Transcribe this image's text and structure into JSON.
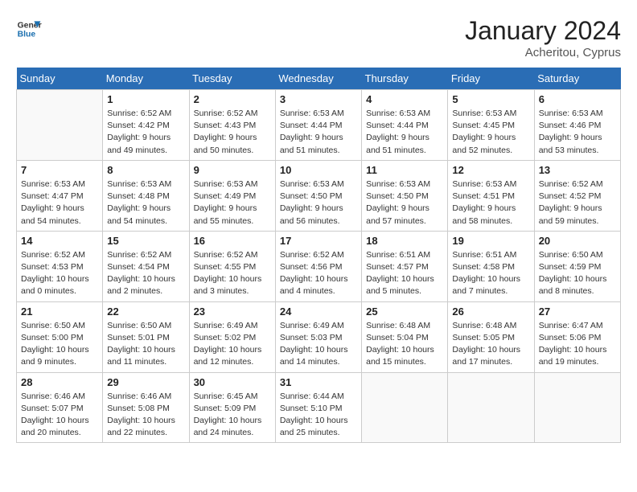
{
  "header": {
    "logo_line1": "General",
    "logo_line2": "Blue",
    "month_year": "January 2024",
    "location": "Acheritou, Cyprus"
  },
  "weekdays": [
    "Sunday",
    "Monday",
    "Tuesday",
    "Wednesday",
    "Thursday",
    "Friday",
    "Saturday"
  ],
  "weeks": [
    [
      {
        "day": "",
        "info": ""
      },
      {
        "day": "1",
        "info": "Sunrise: 6:52 AM\nSunset: 4:42 PM\nDaylight: 9 hours\nand 49 minutes."
      },
      {
        "day": "2",
        "info": "Sunrise: 6:52 AM\nSunset: 4:43 PM\nDaylight: 9 hours\nand 50 minutes."
      },
      {
        "day": "3",
        "info": "Sunrise: 6:53 AM\nSunset: 4:44 PM\nDaylight: 9 hours\nand 51 minutes."
      },
      {
        "day": "4",
        "info": "Sunrise: 6:53 AM\nSunset: 4:44 PM\nDaylight: 9 hours\nand 51 minutes."
      },
      {
        "day": "5",
        "info": "Sunrise: 6:53 AM\nSunset: 4:45 PM\nDaylight: 9 hours\nand 52 minutes."
      },
      {
        "day": "6",
        "info": "Sunrise: 6:53 AM\nSunset: 4:46 PM\nDaylight: 9 hours\nand 53 minutes."
      }
    ],
    [
      {
        "day": "7",
        "info": ""
      },
      {
        "day": "8",
        "info": "Sunrise: 6:53 AM\nSunset: 4:48 PM\nDaylight: 9 hours\nand 54 minutes."
      },
      {
        "day": "9",
        "info": "Sunrise: 6:53 AM\nSunset: 4:49 PM\nDaylight: 9 hours\nand 55 minutes."
      },
      {
        "day": "10",
        "info": "Sunrise: 6:53 AM\nSunset: 4:50 PM\nDaylight: 9 hours\nand 56 minutes."
      },
      {
        "day": "11",
        "info": "Sunrise: 6:53 AM\nSunset: 4:50 PM\nDaylight: 9 hours\nand 57 minutes."
      },
      {
        "day": "12",
        "info": "Sunrise: 6:53 AM\nSunset: 4:51 PM\nDaylight: 9 hours\nand 58 minutes."
      },
      {
        "day": "13",
        "info": "Sunrise: 6:52 AM\nSunset: 4:52 PM\nDaylight: 9 hours\nand 59 minutes."
      }
    ],
    [
      {
        "day": "14",
        "info": ""
      },
      {
        "day": "15",
        "info": "Sunrise: 6:52 AM\nSunset: 4:54 PM\nDaylight: 10 hours\nand 2 minutes."
      },
      {
        "day": "16",
        "info": "Sunrise: 6:52 AM\nSunset: 4:55 PM\nDaylight: 10 hours\nand 3 minutes."
      },
      {
        "day": "17",
        "info": "Sunrise: 6:52 AM\nSunset: 4:56 PM\nDaylight: 10 hours\nand 4 minutes."
      },
      {
        "day": "18",
        "info": "Sunrise: 6:51 AM\nSunset: 4:57 PM\nDaylight: 10 hours\nand 5 minutes."
      },
      {
        "day": "19",
        "info": "Sunrise: 6:51 AM\nSunset: 4:58 PM\nDaylight: 10 hours\nand 7 minutes."
      },
      {
        "day": "20",
        "info": "Sunrise: 6:50 AM\nSunset: 4:59 PM\nDaylight: 10 hours\nand 8 minutes."
      }
    ],
    [
      {
        "day": "21",
        "info": ""
      },
      {
        "day": "22",
        "info": "Sunrise: 6:50 AM\nSunset: 5:01 PM\nDaylight: 10 hours\nand 11 minutes."
      },
      {
        "day": "23",
        "info": "Sunrise: 6:49 AM\nSunset: 5:02 PM\nDaylight: 10 hours\nand 12 minutes."
      },
      {
        "day": "24",
        "info": "Sunrise: 6:49 AM\nSunset: 5:03 PM\nDaylight: 10 hours\nand 14 minutes."
      },
      {
        "day": "25",
        "info": "Sunrise: 6:48 AM\nSunset: 5:04 PM\nDaylight: 10 hours\nand 15 minutes."
      },
      {
        "day": "26",
        "info": "Sunrise: 6:48 AM\nSunset: 5:05 PM\nDaylight: 10 hours\nand 17 minutes."
      },
      {
        "day": "27",
        "info": "Sunrise: 6:47 AM\nSunset: 5:06 PM\nDaylight: 10 hours\nand 19 minutes."
      }
    ],
    [
      {
        "day": "28",
        "info": ""
      },
      {
        "day": "29",
        "info": "Sunrise: 6:46 AM\nSunset: 5:08 PM\nDaylight: 10 hours\nand 22 minutes."
      },
      {
        "day": "30",
        "info": "Sunrise: 6:45 AM\nSunset: 5:09 PM\nDaylight: 10 hours\nand 24 minutes."
      },
      {
        "day": "31",
        "info": "Sunrise: 6:44 AM\nSunset: 5:10 PM\nDaylight: 10 hours\nand 25 minutes."
      },
      {
        "day": "",
        "info": ""
      },
      {
        "day": "",
        "info": ""
      },
      {
        "day": "",
        "info": ""
      }
    ]
  ],
  "week1_day7_info": "Sunrise: 6:53 AM\nSunset: 4:47 PM\nDaylight: 9 hours\nand 54 minutes.",
  "week3_day14_info": "Sunrise: 6:52 AM\nSunset: 4:53 PM\nDaylight: 10 hours\nand 0 minutes.",
  "week4_day21_info": "Sunrise: 6:50 AM\nSunset: 5:00 PM\nDaylight: 10 hours\nand 9 minutes.",
  "week5_day28_info": "Sunrise: 6:46 AM\nSunset: 5:07 PM\nDaylight: 10 hours\nand 20 minutes."
}
